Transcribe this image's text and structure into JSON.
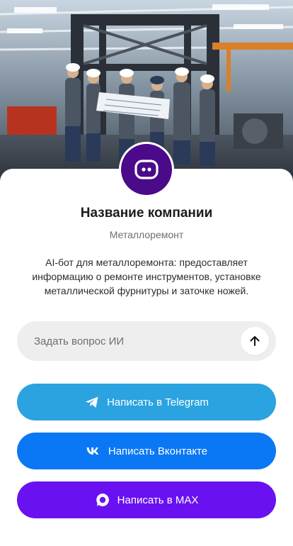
{
  "company": {
    "name": "Название компании",
    "category": "Металлоремонт",
    "description": "AI-бот для металлоремонта: предоставляет информацию о ремонте инструментов, установке металлической фурнитуры и заточке ножей."
  },
  "ask": {
    "placeholder": "Задать вопрос ИИ"
  },
  "actions": [
    {
      "label": "Написать в Telegram",
      "icon": "telegram-icon",
      "color": "#2aa3e0"
    },
    {
      "label": "Написать Вконтакте",
      "icon": "vk-icon",
      "color": "#0a77f5"
    },
    {
      "label": "Написать в MAX",
      "icon": "max-icon",
      "color": "#6a11f2"
    }
  ],
  "colors": {
    "avatar_bg": "#4a0a8a",
    "ask_bg": "#eeeeef"
  }
}
